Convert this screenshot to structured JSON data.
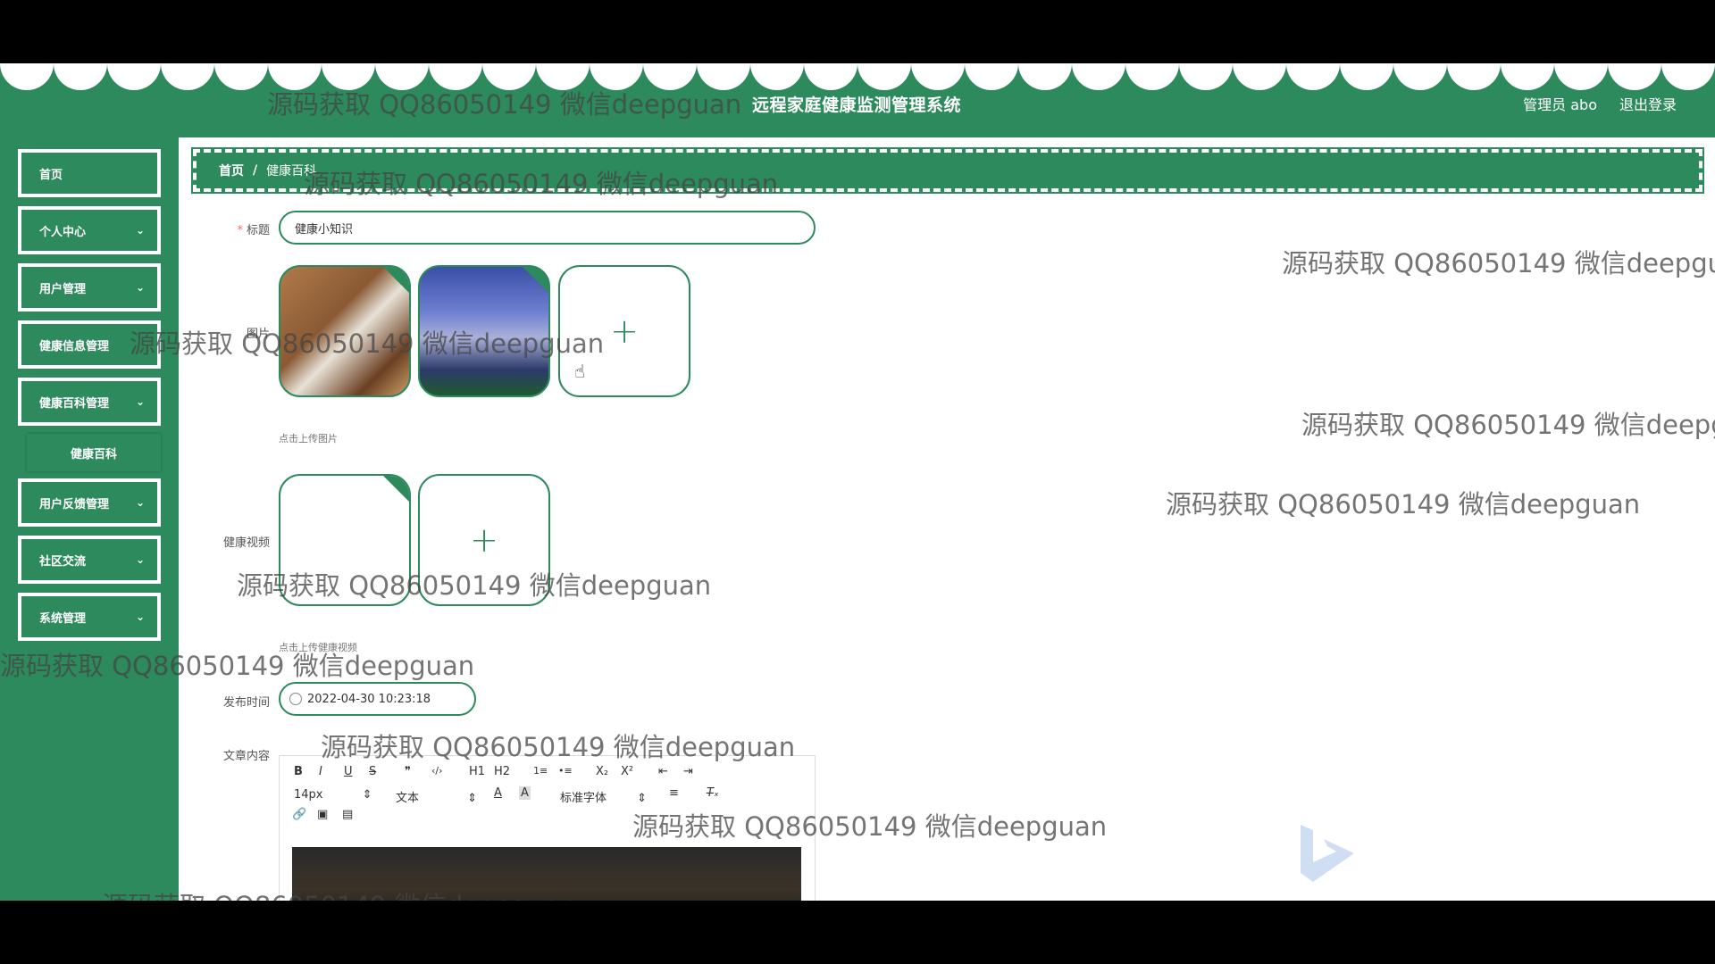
{
  "app": {
    "title": "远程家庭健康监测管理系统",
    "user": "管理员 abo",
    "logout": "退出登录",
    "accent_color": "#2c8a5c"
  },
  "sidebar": {
    "items": [
      {
        "label": "首页",
        "has_arrow": false
      },
      {
        "label": "个人中心",
        "has_arrow": true
      },
      {
        "label": "用户管理",
        "has_arrow": true
      },
      {
        "label": "健康信息管理",
        "has_arrow": false
      },
      {
        "label": "健康百科管理",
        "has_arrow": true
      },
      {
        "label": "用户反馈管理",
        "has_arrow": true
      },
      {
        "label": "社区交流",
        "has_arrow": true
      },
      {
        "label": "系统管理",
        "has_arrow": true
      }
    ],
    "sub_item": "健康百科"
  },
  "breadcrumb": {
    "home": "首页",
    "separator": "/",
    "current": "健康百科"
  },
  "form": {
    "title_label": "标题",
    "title_value": "健康小知识",
    "image_label": "图片",
    "image_tip": "点击上传图片",
    "video_label": "健康视频",
    "video_tip": "点击上传健康视频",
    "date_label": "发布时间",
    "date_value": "2022-04-30 10:23:18",
    "content_label": "文章内容",
    "upload_symbol": "+"
  },
  "editor": {
    "font_size": "14px",
    "block_type": "文本",
    "font_family": "标准字体",
    "buttons": [
      "B",
      "I",
      "U",
      "S",
      "❞",
      "‹/›",
      "H1",
      "H2",
      "1≡",
      "•≡",
      "X₂",
      "X²",
      "⇤",
      "⇥"
    ]
  },
  "watermark": "源码获取 QQ86050149 微信deepguan"
}
